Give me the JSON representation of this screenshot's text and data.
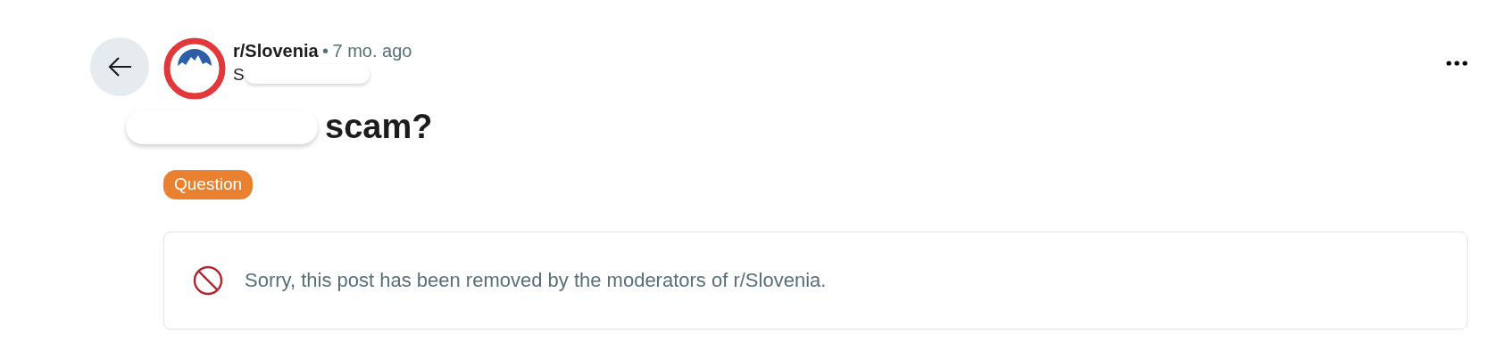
{
  "post": {
    "subreddit": "r/Slovenia",
    "separator": "•",
    "age": "7 mo. ago",
    "author": "S",
    "title": "scam?",
    "flair": {
      "label": "Question",
      "color": "#ea8131"
    },
    "removed_notice": "Sorry, this post has been removed by the moderators of r/Slovenia."
  }
}
